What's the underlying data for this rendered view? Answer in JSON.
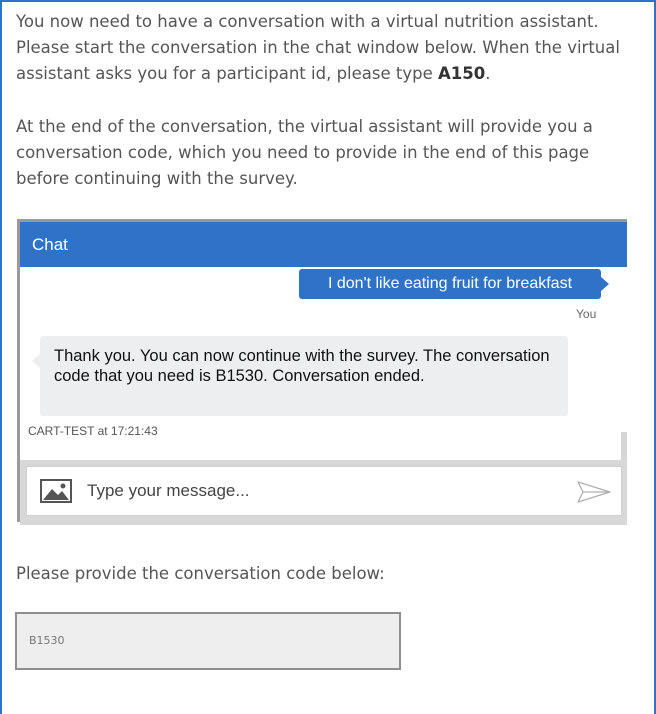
{
  "intro": {
    "line1_prefix": "You now need to have a conversation with a virtual nutrition assistant. Please start the conversation in the chat window below. When the virtual assistant asks you for a participant id, please type ",
    "participant_id": "A150",
    "line1_suffix": ".",
    "paragraph2": "At the end of the conversation, the virtual assistant will provide you a conversation code, which you need to provide in the end of this page before continuing with the survey."
  },
  "chat": {
    "header_title": "Chat",
    "messages": [
      {
        "sender": "You",
        "text": "I don't like eating fruit for breakfast"
      },
      {
        "sender": "CART-TEST",
        "text": "Thank you. You can now continue with the survey. The conversation code that you need is B1530. Conversation ended.",
        "meta": "CART-TEST at 17:21:43"
      }
    ],
    "composer_placeholder": "Type your message..."
  },
  "code_prompt": "Please provide the conversation code below:",
  "code_field": {
    "value": "B1530"
  },
  "colors": {
    "accent": "#2f73c8",
    "bubble_in": "#eceef0"
  }
}
